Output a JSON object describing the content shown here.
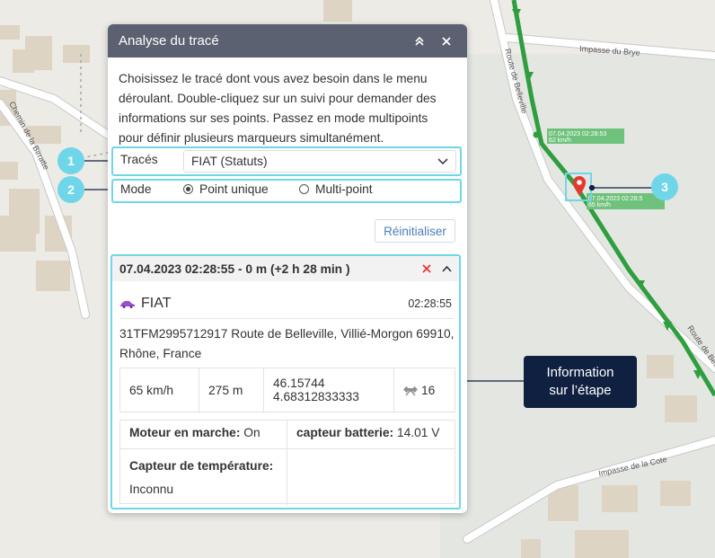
{
  "map": {
    "streets": [
      "Impasse du Brye",
      "Route de Belleville",
      "Chemin de la Birratte",
      "Impasse de la Cote"
    ],
    "track_labels": [
      {
        "date": "07.04.2023 02:28:53",
        "speed": "62 km/h"
      },
      {
        "date": "07.04.2023 02:28:5",
        "speed": "65 km/h"
      }
    ],
    "route_color": "#2e9e3f"
  },
  "panel": {
    "title": "Analyse du tracé",
    "intro": "Choisissez le tracé dont vous avez besoin dans le menu déroulant. Double-cliquez sur un suivi pour demander des informations sur ses points. Passez en mode multipoints pour définir plusieurs marqueurs simultanément.",
    "tracks_label": "Tracés",
    "tracks_value": "FIAT (Statuts)",
    "mode_label": "Mode",
    "mode_single": "Point unique",
    "mode_multi": "Multi-point",
    "mode_selected": "single",
    "reset_label": "Réinitialiser"
  },
  "step": {
    "header": "07.04.2023 02:28:55 - 0 m (+2 h 28 min )",
    "vehicle": "FIAT",
    "time": "02:28:55",
    "address": "31TFM2995712917 Route de Belleville, Villié-Morgon 69910, Rhône, France",
    "speed": "65 km/h",
    "altitude": "275 m",
    "lat": "46.15744",
    "lon": "4.68312833333",
    "satellites": "16",
    "engine_label": "Moteur en marche:",
    "engine_value": "On",
    "battery_label": "capteur batterie:",
    "battery_value": "14.01 V",
    "temp_label": "Capteur de température:",
    "temp_value": "Inconnu"
  },
  "callouts": [
    "1",
    "2",
    "3"
  ],
  "info_box": {
    "line1": "Information",
    "line2": "sur l’étape"
  },
  "colors": {
    "accent": "#6fd6ea",
    "header": "#5b6170",
    "delete": "#e33",
    "info_bg": "#0f2040"
  }
}
